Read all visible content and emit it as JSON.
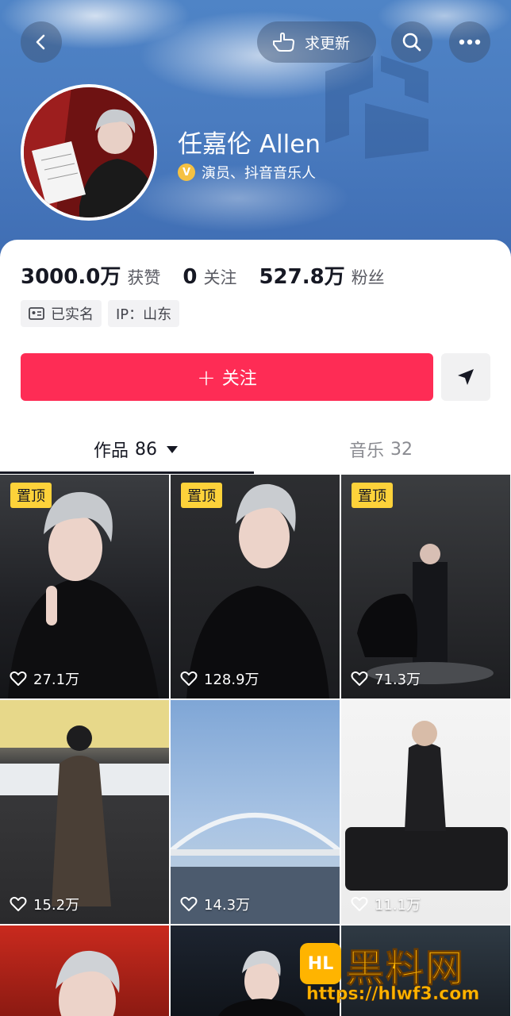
{
  "header": {
    "update_label": "求更新"
  },
  "profile": {
    "name": "任嘉伦 Allen",
    "verification": "演员、抖音音乐人",
    "badge": "V"
  },
  "stats": [
    {
      "value": "3000.0万",
      "label": "获赞"
    },
    {
      "value": "0",
      "label": "关注"
    },
    {
      "value": "527.8万",
      "label": "粉丝"
    }
  ],
  "tags": {
    "realname": "已实名",
    "ip": "IP：山东"
  },
  "actions": {
    "follow_label": "关注",
    "follow_plus": "+"
  },
  "tabs": {
    "works_label": "作品",
    "works_count": "86",
    "music_label": "音乐",
    "music_count": "32"
  },
  "videos": [
    {
      "pinned": "置顶",
      "likes": "27.1万"
    },
    {
      "pinned": "置顶",
      "likes": "128.9万"
    },
    {
      "pinned": "置顶",
      "likes": "71.3万"
    },
    {
      "likes": "15.2万"
    },
    {
      "likes": "14.3万"
    },
    {
      "likes": "11.1万"
    }
  ],
  "watermark": {
    "logo": "HL",
    "title": "黑料网",
    "url": "https://hlwf3.com"
  },
  "colors": {
    "accent": "#fe2c55",
    "pin": "#fdd23a",
    "banner": "#4a7cc0"
  }
}
